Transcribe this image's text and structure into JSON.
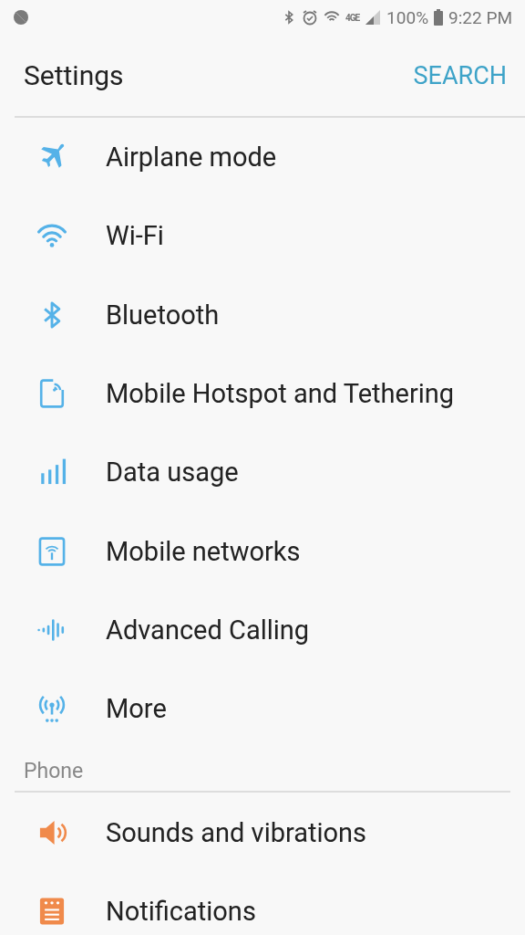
{
  "status_bar": {
    "network": "4GE",
    "battery": "100%",
    "time": "9:22 PM"
  },
  "header": {
    "title": "Settings",
    "action": "SEARCH"
  },
  "sections": [
    {
      "color": "#55b2e8",
      "items": [
        {
          "label": "Airplane mode",
          "kind": "airplane"
        },
        {
          "label": "Wi-Fi",
          "kind": "wifi"
        },
        {
          "label": "Bluetooth",
          "kind": "bluetooth"
        },
        {
          "label": "Mobile Hotspot and Tethering",
          "kind": "hotspot"
        },
        {
          "label": "Data usage",
          "kind": "bars"
        },
        {
          "label": "Mobile networks",
          "kind": "network"
        },
        {
          "label": "Advanced Calling",
          "kind": "wave"
        },
        {
          "label": "More",
          "kind": "antenna"
        }
      ]
    },
    {
      "title": "Phone",
      "color": "#f08a4b",
      "items": [
        {
          "label": "Sounds and vibrations",
          "kind": "speaker"
        },
        {
          "label": "Notifications",
          "kind": "notes"
        }
      ]
    }
  ]
}
